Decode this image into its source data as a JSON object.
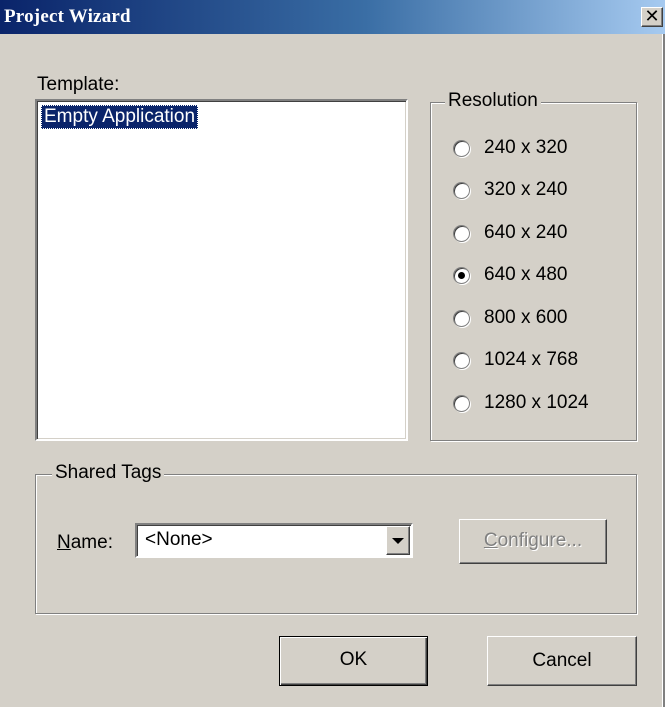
{
  "window": {
    "title": "Project Wizard",
    "close_glyph": "✕"
  },
  "template": {
    "label": "Template:",
    "items": [
      "Empty Application"
    ],
    "selected_index": 0
  },
  "resolution": {
    "legend": "Resolution",
    "options": [
      "240 x 320",
      "320 x 240",
      "640 x 240",
      "640 x 480",
      "800 x 600",
      "1024 x 768",
      "1280 x 1024"
    ],
    "selected": "640 x 480"
  },
  "shared_tags": {
    "legend": "Shared Tags",
    "name_label_mnemonic": "N",
    "name_label_rest": "ame:",
    "name_value": "<None>",
    "configure_mnemonic": "C",
    "configure_rest": "onfigure..."
  },
  "buttons": {
    "ok": "OK",
    "cancel": "Cancel"
  },
  "colors": {
    "title_bar": "#0a246a",
    "dialog_face": "#d4d0c8",
    "selection": "#0a246a"
  }
}
